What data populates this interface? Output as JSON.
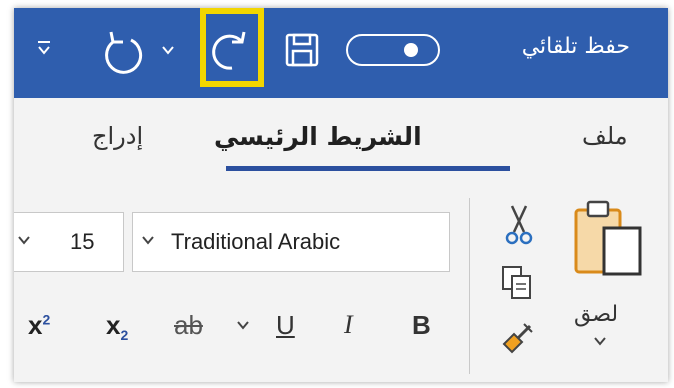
{
  "quick_access": {
    "autosave_label": "حفظ تلقائي",
    "highlight_color": "#f2d600",
    "bar_color": "#2f5eae",
    "icons": [
      "customize-chevron-icon",
      "undo-icon",
      "undo-dropdown-icon",
      "redo-icon",
      "save-icon",
      "autosave-toggle"
    ]
  },
  "tabs": {
    "file": "ملف",
    "home": "الشريط الرئيسي",
    "insert": "إدراج",
    "active": "home"
  },
  "font": {
    "name": "Traditional Arabic",
    "size": "15"
  },
  "format_buttons": {
    "superscript": "x",
    "superscript_mark": "2",
    "subscript": "x",
    "subscript_mark": "2",
    "strikethrough": "ab",
    "underline": "U",
    "italic": "I",
    "bold": "B"
  },
  "clipboard": {
    "paste_label": "لصق"
  }
}
